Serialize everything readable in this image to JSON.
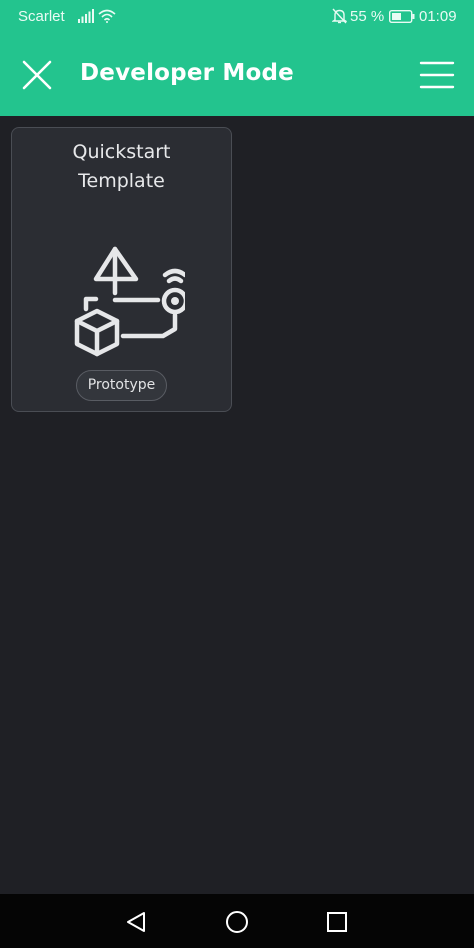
{
  "status_bar": {
    "carrier": "Scarlet",
    "battery_percent": "55 %",
    "time": "01:09"
  },
  "app_bar": {
    "title": "Developer Mode"
  },
  "templates": [
    {
      "title": "Quickstart\nTemplate",
      "badge": "Prototype"
    }
  ],
  "icons": {
    "close": "close-icon",
    "menu": "hamburger-menu-icon",
    "signal": "signal-icon",
    "wifi": "wifi-icon",
    "bell_muted": "bell-muted-icon",
    "battery": "battery-icon",
    "nav_back": "back-triangle-icon",
    "nav_home": "home-circle-icon",
    "nav_recents": "recents-square-icon"
  },
  "colors": {
    "accent": "#23c48e",
    "background": "#1f2025",
    "card": "#2b2d33"
  }
}
